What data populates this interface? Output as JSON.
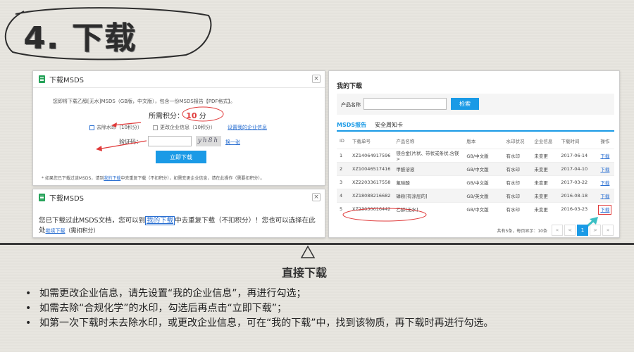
{
  "title": "4. 下载",
  "dialog1": {
    "header": "下载MSDS",
    "description": "您即将下载乙醇[无水]MSDS（GB版，中文版），包含一份MSDS报告【PDF格式】。",
    "points_label": "所需积分：",
    "points_value": "10",
    "points_unit": "分",
    "opt_remove_watermark": "去除水印（10积分）",
    "opt_update_company": "更改企业信息（10积分）",
    "set_company_link": "设置我的企业信息",
    "captcha_label": "验证码：",
    "captcha_image_text": "yh8h",
    "captcha_refresh": "换一张",
    "download_button": "立即下载",
    "note_prefix": "* 如果您已下载过该MSDS，请到",
    "note_link": "我的下载",
    "note_suffix": "中去重复下载（不扣积分），如需变更企业信息，请在此操作（需要扣积分）。"
  },
  "dialog2": {
    "header": "下载MSDS",
    "text_prefix": "您已下载过此MSDS文档，您可以到",
    "text_link": "我的下载",
    "text_middle": "中去重复下载（不扣积分）！您也可以选择在此处",
    "text_link2": "继续下载",
    "text_suffix": "（需扣积分）"
  },
  "downloads": {
    "heading": "我的下载",
    "product_label": "产品名称",
    "search_button": "检索",
    "tabs": [
      "MSDS报告",
      "安全周知卡"
    ],
    "columns": [
      "ID",
      "下载单号",
      "产品名称",
      "版本",
      "水印状况",
      "企业信息",
      "下载时间",
      "操作"
    ],
    "rows": [
      {
        "id": "1",
        "order": "XZ14064917596",
        "name": "镁合金[片状、带状或条状,含镁>",
        "version": "GB/中文版",
        "watermark": "有水印",
        "company": "未变更",
        "time": "2017-06-14",
        "action": "下载"
      },
      {
        "id": "2",
        "order": "XZ10046517416",
        "name": "甲醛溶液",
        "version": "GB/中文版",
        "watermark": "有水印",
        "company": "未变更",
        "time": "2017-04-10",
        "action": "下载"
      },
      {
        "id": "3",
        "order": "XZ22033617558",
        "name": "氟硅酸",
        "version": "GB/中文版",
        "watermark": "有水印",
        "company": "未变更",
        "time": "2017-03-22",
        "action": "下载"
      },
      {
        "id": "4",
        "order": "XZ18088216682",
        "name": "磷粉[有涂层的]",
        "version": "GB/英文版",
        "watermark": "有水印",
        "company": "未变更",
        "time": "2016-08-18",
        "action": "下载"
      },
      {
        "id": "5",
        "order": "XZ23030616442",
        "name": "乙醇[无水]",
        "version": "GB/中文版",
        "watermark": "有水印",
        "company": "未变更",
        "time": "2016-03-23",
        "action": "下载"
      }
    ],
    "pager_info": "共有5条，每页显示：10条",
    "pager_prev2": "«",
    "pager_prev": "<",
    "pager_current": "1",
    "pager_next": ">",
    "pager_next2": "»"
  },
  "direct_download_label": "直接下载",
  "bullets": [
    "如需更改企业信息，请先设置“我的企业信息”，再进行勾选；",
    "如需去除“合规化学”的水印，勾选后再点击“立即下载”；",
    "如第一次下载时未去除水印，或更改企业信息，可在“我的下载”中，找到该物质，再下载时再进行勾选。"
  ],
  "colors": {
    "accent_blue": "#1a9ae6",
    "highlight_red": "#e03a3a",
    "arrow_teal": "#3bbfc4",
    "brand_green": "#27a35a"
  }
}
